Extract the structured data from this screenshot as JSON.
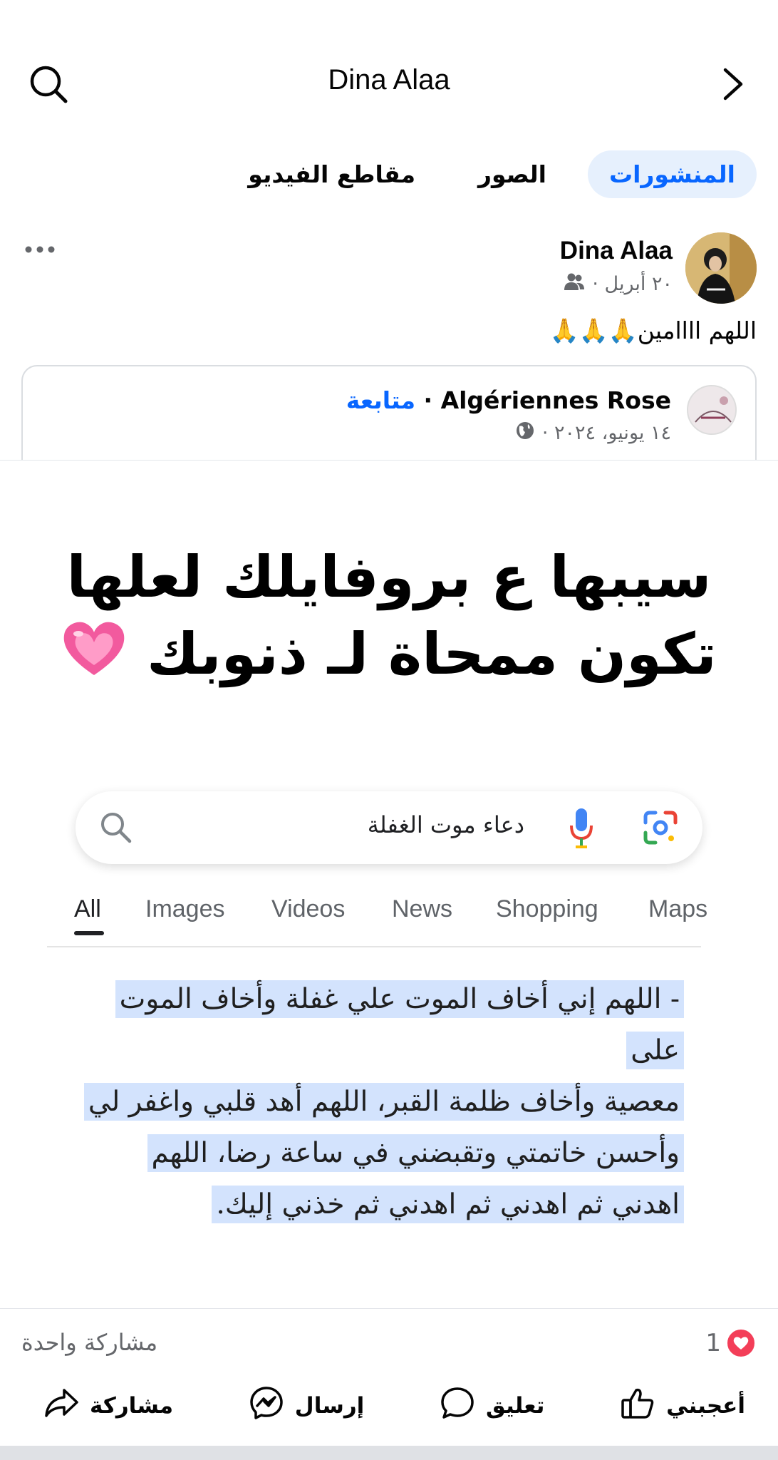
{
  "header": {
    "title": "Dina Alaa",
    "search_icon": "search-icon",
    "back_icon": "chevron-right-icon"
  },
  "tabs": [
    {
      "label": "المنشورات",
      "active": true
    },
    {
      "label": "الصور",
      "active": false
    },
    {
      "label": "مقاطع الفيديو",
      "active": false
    }
  ],
  "post": {
    "author": "Dina Alaa",
    "date": "٢٠ أبريل ·",
    "audience_icon": "friends-icon",
    "text": "اللهم اااامين🙏🙏🙏",
    "more_icon": "more-dots-icon"
  },
  "shared": {
    "page_name": "Algériennes Rose",
    "separator": " · ",
    "follow_label": "متابعة",
    "date": "١٤ يونيو، ٢٠٢٤ ·",
    "audience_icon": "globe-icon"
  },
  "image": {
    "headline_line1": "سيبها ع بروفايلك لعلها",
    "headline_line2": "تكون ممحاة لـ ذنوبك",
    "headline_emoji": "heart-emoji",
    "search_query": "دعاء موت الغفلة",
    "google_tabs": [
      "All",
      "Images",
      "Videos",
      "News",
      "Shopping",
      "Maps"
    ],
    "active_google_tab": "All",
    "answer_lines": [
      "- اللهم إني أخاف الموت علي غفلة وأخاف الموت على",
      "معصية وأخاف ظلمة القبر، اللهم أهد قلبي واغفر لي",
      "وأحسن خاتمتي وتقبضني في ساعة رضا، اللهم",
      "اهدني ثم اهدني ثم اهدني ثم خذني إليك."
    ]
  },
  "stats": {
    "reaction_count": "1",
    "shares": "مشاركة واحدة"
  },
  "actions": {
    "like": "أعجبني",
    "comment": "تعليق",
    "send": "إرسال",
    "share": "مشاركة"
  },
  "colors": {
    "accent": "#0866ff",
    "active_tab_bg": "#e6f0fd",
    "highlight": "#d3e3fd",
    "love": "#f33e58",
    "secondary_text": "#65676b"
  }
}
